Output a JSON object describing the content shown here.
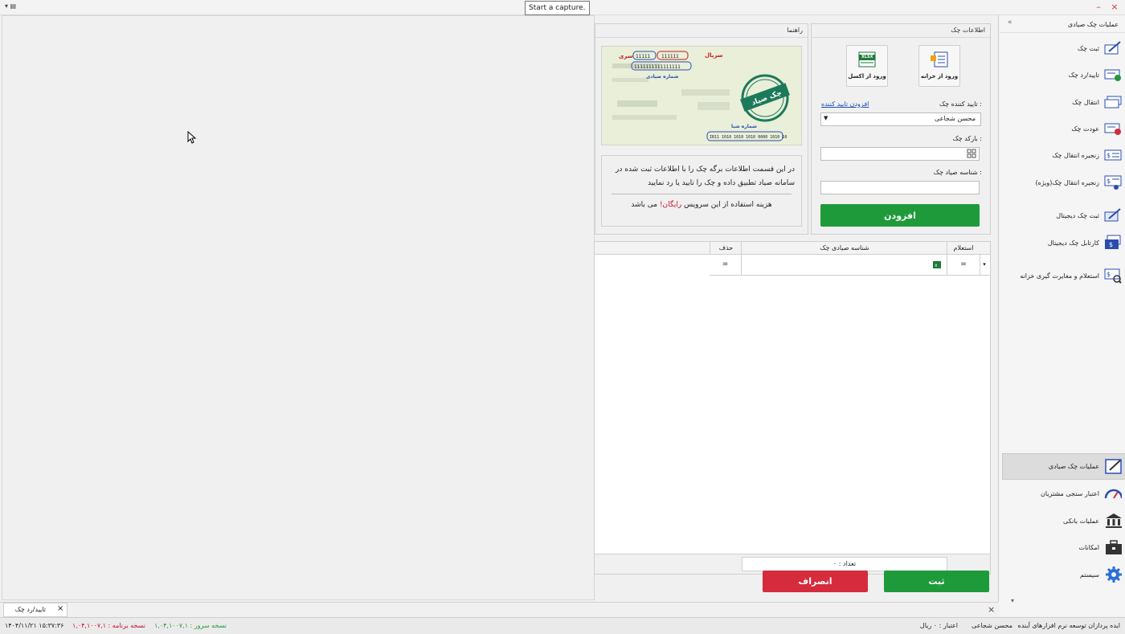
{
  "tooltip": "Start a capture.",
  "window": {
    "close": "×",
    "minimize": "–"
  },
  "sidebar": {
    "header": "عملیات چک صیادی",
    "collapse": "«",
    "items": [
      {
        "label": "ثبت چک",
        "icon": "pen-check-icon"
      },
      {
        "label": "تایید/رد چک",
        "icon": "check-approve-icon"
      },
      {
        "label": "انتقال چک",
        "icon": "check-transfer-icon"
      },
      {
        "label": "عودت چک",
        "icon": "check-return-icon"
      },
      {
        "label": "زنجیره انتقال چک",
        "icon": "transfer-chain-icon"
      },
      {
        "label": "زنجیره انتقال چک(ویژه)",
        "icon": "transfer-chain-special-icon"
      },
      {
        "label": "ثبت چک دیجیتال",
        "icon": "digital-check-icon"
      },
      {
        "label": "کارتابل چک دیجیتال",
        "icon": "digital-cartable-icon"
      },
      {
        "label": "استعلام و مغایرت گیری خزانه",
        "icon": "treasury-inquiry-icon"
      }
    ],
    "modules": [
      {
        "label": "عملیات چک صیادی",
        "icon": "edit-board-icon",
        "active": true
      },
      {
        "label": "اعتبار سنجی مشتریان",
        "icon": "gauge-icon"
      },
      {
        "label": "عملیات بانکی",
        "icon": "bank-icon"
      },
      {
        "label": "امکانات",
        "icon": "toolbox-icon"
      },
      {
        "label": "سیستم",
        "icon": "gear-icon"
      }
    ],
    "scroll_down": "▾"
  },
  "info_panel": {
    "title": "اطلاعات چک",
    "btn_treasury": "ورود از خزانه",
    "btn_excel": "ورود از اکسل",
    "excel_badge": "XLSX",
    "approver_label": "تایید کننده چک :",
    "add_approver_link": "افزودن تایید کننده",
    "approver_value": "محسن شجاعی",
    "barcode_label": "بارکد چک :",
    "sayad_label": "شناسه صیاد چک :",
    "add_button": "افزودن"
  },
  "guide_panel": {
    "title": "راهنما",
    "check_image": {
      "serial_label": "سریال",
      "serial_value": "111111",
      "series_label": "سری",
      "series_value": "11111",
      "long_number": "1111111111111111",
      "sayad_caption": "شماره صیادی",
      "stamp_text": "چک صیاد",
      "sheba_caption": "شماره شبا",
      "sheba_value": "IR11 1010 1010 1010 0000 1010 10"
    },
    "text1": "در این قسمت اطلاعات برگه چک را با اطلاعات ثبت شده در سامانه صیاد تطبیق داده و چک را تایید یا رد نمایید",
    "cost_text": "هزینه استفاده از این سرویس",
    "free_text": "رایگان!",
    "cost_tail": "می باشد"
  },
  "grid": {
    "columns": [
      "استعلام",
      "شناسه صیادی چک",
      "حذف"
    ],
    "row_indicator": "▾",
    "filter_symbol": "=",
    "count_label": "تعداد : ۰"
  },
  "actions": {
    "submit": "ثبت",
    "cancel": "انصراف"
  },
  "tabs": [
    {
      "label": "تایید/رد چک",
      "close": "×"
    }
  ],
  "tabbar_close": "×",
  "statusbar": {
    "company": "ایده پردازان توسعه نرم افزارهای آینده",
    "user": "محسن شجاعی",
    "credit": "اعتبار : ۰ ریال",
    "server_version": "نسخه سرور : ۱,۰۴,۱۰۰۷,۱",
    "app_version": "نسخه برنامه : ۱,۰۴,۱۰۰۷,۱",
    "datetime": "۱۴۰۴/۱۱/۲۱ ۱۵:۳۷:۳۶"
  },
  "colors": {
    "green": "#1f9a3a",
    "red": "#d62b3d",
    "link": "#1a4fb0",
    "free": "#c8102e"
  }
}
